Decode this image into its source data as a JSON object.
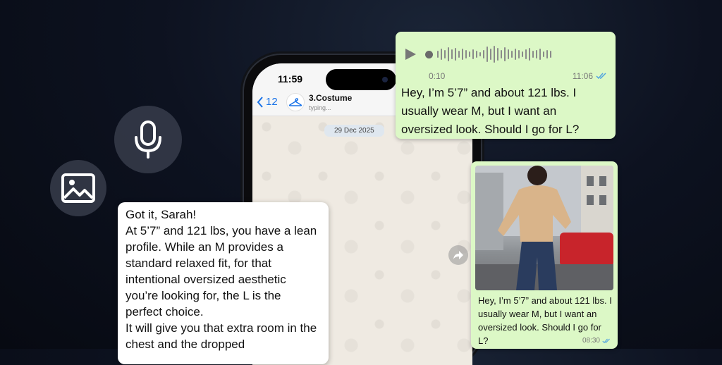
{
  "statusbar": {
    "time": "11:59"
  },
  "chat": {
    "back_count": "12",
    "contact_name": "3.Costume",
    "contact_status": "typing...",
    "date_label": "29 Dec 2025"
  },
  "voice_message": {
    "duration": "0:10",
    "time": "11:06",
    "text": "Hey, I’m 5’7” and about 121 lbs. I usually wear M, but I want an oversized look. Should I go for L?"
  },
  "photo_message": {
    "caption": "Hey, I’m 5’7” and about 121 lbs. I usually wear M, but I want an oversized look. Should I go for L?",
    "time": "08:30"
  },
  "reply_message": {
    "line1": "Got it, Sarah!",
    "line2": "At 5’7” and 121 lbs, you have a lean profile. While an M provides a standard relaxed fit, for that intentional oversized aesthetic you’re looking for, the L is the perfect choice.",
    "line3": "It will give you that extra room in the chest and the dropped"
  },
  "icons": {
    "microphone": "microphone-icon",
    "image": "image-icon",
    "play": "play-icon",
    "forward": "forward-icon",
    "back": "chevron-left-icon",
    "hanger": "hanger-icon",
    "read_receipt": "double-check-icon"
  },
  "colors": {
    "outgoing_bubble": "#dcf8c6",
    "incoming_bubble": "#ffffff",
    "accent_blue": "#1a73e8",
    "read_tick": "#4fa3e0"
  }
}
